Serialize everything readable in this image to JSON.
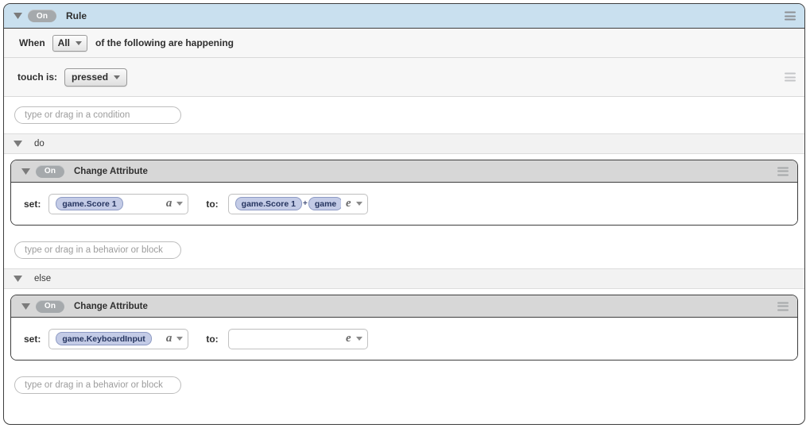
{
  "rule": {
    "toggle_label": "On",
    "title": "Rule",
    "menu_icon": "hamburger-icon",
    "disclosure_icon": "triangle-down-icon"
  },
  "when": {
    "prefix": "When",
    "selector_value": "All",
    "suffix": "of the following are happening"
  },
  "condition": {
    "label": "touch is:",
    "selector_value": "pressed",
    "menu_icon": "hamburger-icon"
  },
  "condition_drop": {
    "placeholder": "type or drag in a condition"
  },
  "sections": [
    {
      "label": "do"
    },
    {
      "label": "else"
    }
  ],
  "behaviors": [
    {
      "toggle_label": "On",
      "title": "Change Attribute",
      "menu_icon": "hamburger-icon",
      "set_label": "set:",
      "set_expression": {
        "chips": [
          "game.Score 1"
        ],
        "operators": [],
        "type_glyph": "a"
      },
      "to_label": "to:",
      "to_expression": {
        "chips": [
          "game.Score 1",
          "game"
        ],
        "operators": [
          "+"
        ],
        "type_glyph": "e"
      },
      "drop_placeholder": "type or drag in a behavior or block"
    },
    {
      "toggle_label": "On",
      "title": "Change Attribute",
      "menu_icon": "hamburger-icon",
      "set_label": "set:",
      "set_expression": {
        "chips": [
          "game.KeyboardInput"
        ],
        "operators": [],
        "type_glyph": "a"
      },
      "to_label": "to:",
      "to_expression": {
        "chips": [],
        "operators": [],
        "type_glyph": "e"
      },
      "drop_placeholder": "type or drag in a behavior or block"
    }
  ],
  "colors": {
    "rule_header_bg": "#c9e0ef",
    "behavior_header_bg": "#d7d7d7",
    "toggle_bg": "#a5a9ac",
    "chip_bg": "#c3cbe6",
    "chip_text": "#25345f"
  }
}
